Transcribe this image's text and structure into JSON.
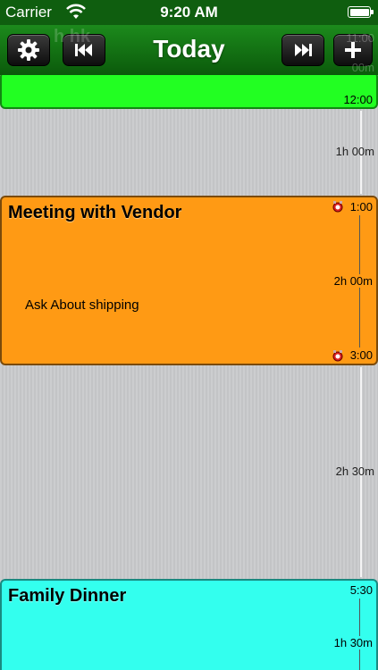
{
  "status_bar": {
    "carrier": "Carrier",
    "time": "9:20 AM",
    "wifi_icon": "wifi-icon",
    "battery_icon": "battery-icon"
  },
  "toolbar": {
    "title": "Today",
    "behind_text": "h hk",
    "behind_time_1": "11:00",
    "behind_time_2": "00m",
    "buttons": [
      {
        "name": "settings-button",
        "icon": "gear-icon"
      },
      {
        "name": "previous-button",
        "icon": "rewind-icon"
      },
      {
        "name": "next-button",
        "icon": "fast-forward-icon"
      },
      {
        "name": "add-button",
        "icon": "plus-icon"
      }
    ]
  },
  "events": [
    {
      "title": "",
      "end_time": "12:00",
      "color": "#22ff22"
    },
    {
      "title": "Meeting with Vendor",
      "start_time": "1:00",
      "duration": "2h 00m",
      "end_time": "3:00",
      "note": "Ask About shipping",
      "alarm_icon": "alarm-icon",
      "color": "#ff9a14"
    },
    {
      "title": "Family Dinner",
      "start_time": "5:30",
      "duration": "1h 30m",
      "color": "#33ffee"
    }
  ],
  "gaps": [
    {
      "label": "1h 00m"
    },
    {
      "label": "2h 30m"
    }
  ]
}
